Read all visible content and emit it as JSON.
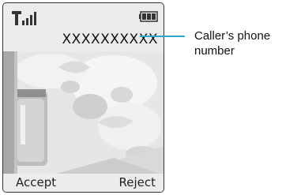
{
  "phone": {
    "caller_number": "XXXXXXXXXX",
    "left_soft_key": "Accept",
    "right_soft_key": "Reject",
    "icons": [
      "signal-strength-icon",
      "battery-icon"
    ]
  },
  "annotation": {
    "label": "Caller’s phone number"
  },
  "colors": {
    "callout": "#2aa8c8",
    "screen_border": "#333333"
  }
}
